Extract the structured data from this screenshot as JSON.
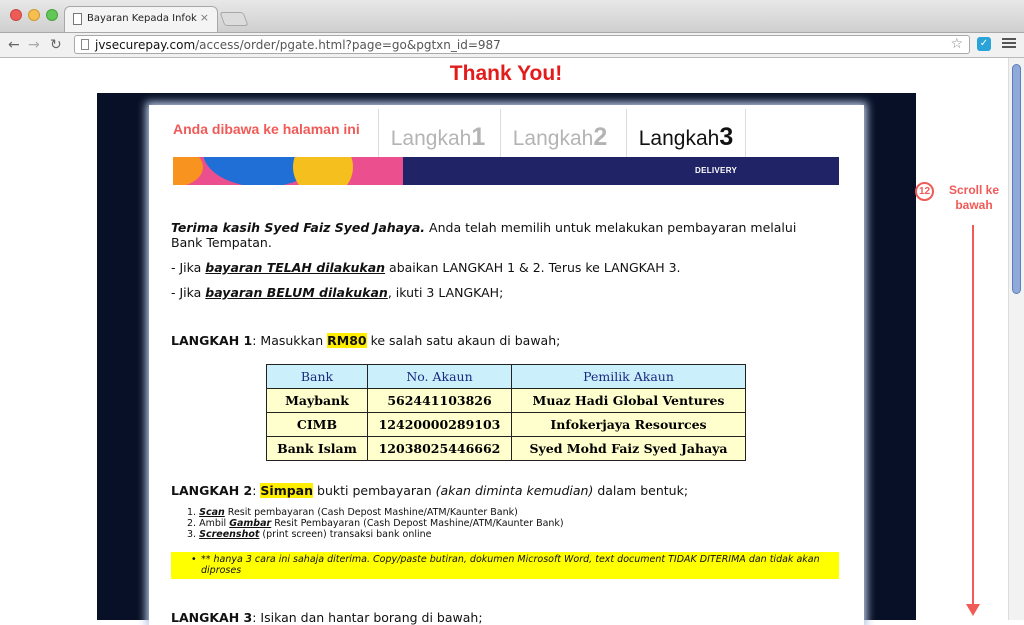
{
  "browser": {
    "tab_title": "Bayaran Kepada Infokerjaya",
    "tab_close": "×",
    "url_host": "jvsecurepay.com",
    "url_path": "/access/order/pgate.html?page=go&pgtxn_id=987",
    "nav_back": "←",
    "nav_forward": "→",
    "nav_reload": "↻",
    "star": "☆",
    "ext_icon": "puzzle-icon"
  },
  "page": {
    "thank_you": "Thank You!",
    "intro_label": "Anda dibawa ke halaman ini",
    "steps": [
      {
        "word": "Langkah",
        "num": "1"
      },
      {
        "word": "Langkah",
        "num": "2"
      },
      {
        "word": "Langkah",
        "num": "3"
      }
    ],
    "banner_label": "DELIVERY",
    "greeting_bold": "Terima kasih Syed Faiz Syed Jahaya.",
    "greeting_rest": " Anda telah memilih untuk melakukan pembayaran melalui Bank Tempatan.",
    "line2_pre": "- Jika ",
    "line2_link": "bayaran TELAH dilakukan",
    "line2_post": " abaikan LANGKAH 1 & 2. Terus ke LANGKAH 3.",
    "line3_pre": "- Jika ",
    "line3_link": "bayaran BELUM dilakukan",
    "line3_post": ", ikuti 3 LANGKAH;",
    "langkah1_label": "LANGKAH 1",
    "langkah1_pre": ": Masukkan ",
    "langkah1_amount": "RM80",
    "langkah1_post": " ke salah satu akaun di bawah;",
    "bank_table": {
      "headers": [
        "Bank",
        "No. Akaun",
        "Pemilik Akaun"
      ],
      "rows": [
        [
          "Maybank",
          "562441103826",
          "Muaz Hadi Global Ventures"
        ],
        [
          "CIMB",
          "12420000289103",
          "Infokerjaya Resources"
        ],
        [
          "Bank Islam",
          "12038025446662",
          "Syed Mohd Faiz Syed Jahaya"
        ]
      ]
    },
    "langkah2_label": "LANGKAH 2",
    "langkah2_colon": ": ",
    "langkah2_simpan": "Simpan",
    "langkah2_mid": " bukti pembayaran ",
    "langkah2_italic": "(akan diminta kemudian)",
    "langkah2_post": " dalam bentuk;",
    "methods": [
      {
        "num": "1.",
        "key": "Scan",
        "text": " Resit pembayaran (Cash Depost Mashine/ATM/Kaunter Bank)"
      },
      {
        "num": "2.",
        "pre": "Ambil ",
        "key": "Gambar",
        "text": " Resit Pembayaran (Cash Depost Mashine/ATM/Kaunter Bank)"
      },
      {
        "num": "3.",
        "key": "Screenshot",
        "text": " (print screen) transaksi bank online"
      }
    ],
    "warning_bullet": "•",
    "warning": "** hanya 3 cara ini sahaja diterima. Copy/paste butiran, dokumen Microsoft Word, text document TIDAK DITERIMA dan tidak akan diproses",
    "langkah3_label": "LANGKAH 3",
    "langkah3_post": ": Isikan dan hantar borang di bawah;"
  },
  "annotation": {
    "number": "12",
    "text": "Scroll ke bawah",
    "color": "#f05a57"
  }
}
